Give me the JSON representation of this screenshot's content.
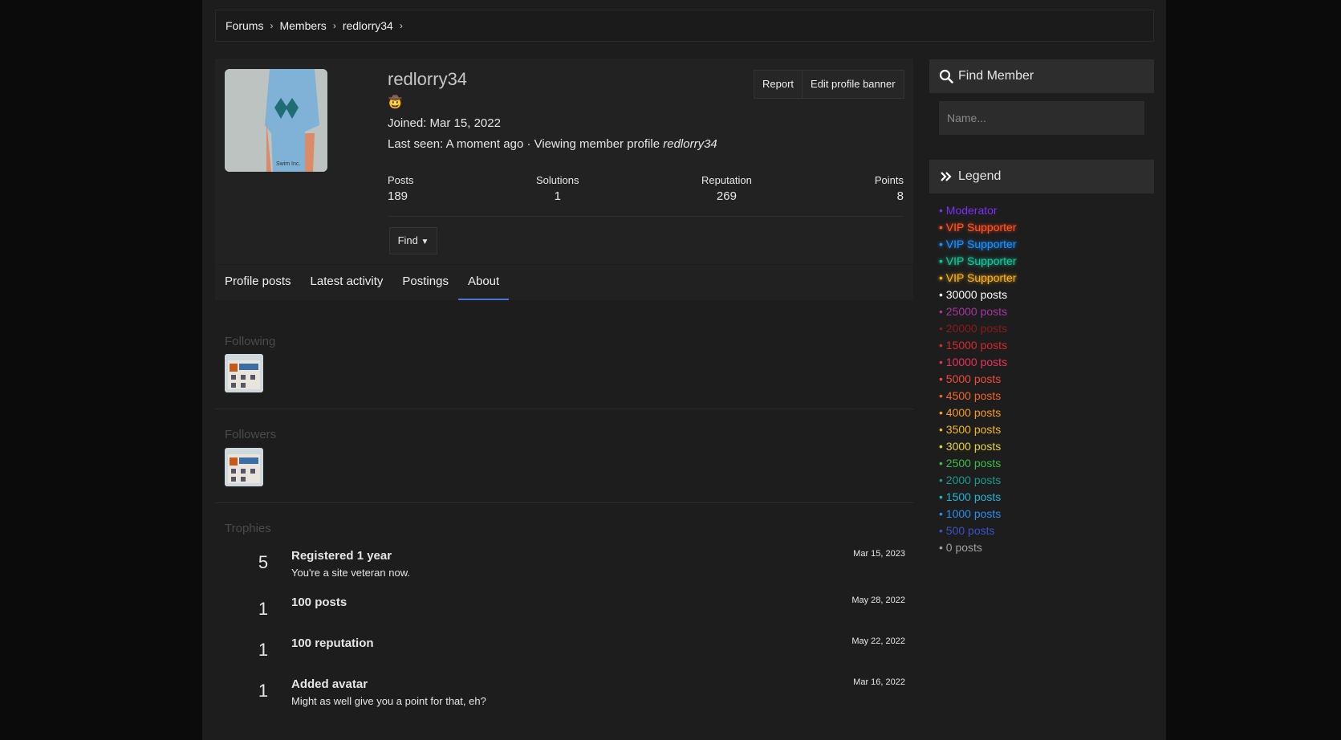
{
  "breadcrumb": {
    "items": [
      "Forums",
      "Members",
      "redlorry34"
    ]
  },
  "profile": {
    "username": "redlorry34",
    "badge_emoji": "🤠",
    "joined_label": "Joined:",
    "joined_value": "Mar 15, 2022",
    "last_seen_label": "Last seen:",
    "last_seen_value": "A moment ago · Viewing member profile",
    "last_seen_target": "redlorry34",
    "report_label": "Report",
    "edit_banner_label": "Edit profile banner",
    "find_label": "Find",
    "avatar_caption": "Swim Inc."
  },
  "stats": [
    {
      "label": "Posts",
      "value": "189"
    },
    {
      "label": "Solutions",
      "value": "1"
    },
    {
      "label": "Reputation",
      "value": "269"
    },
    {
      "label": "Points",
      "value": "8"
    }
  ],
  "tabs": [
    {
      "label": "Profile posts",
      "active": false
    },
    {
      "label": "Latest activity",
      "active": false
    },
    {
      "label": "Postings",
      "active": false
    },
    {
      "label": "About",
      "active": true
    }
  ],
  "about": {
    "following_title": "Following",
    "followers_title": "Followers",
    "trophies_title": "Trophies"
  },
  "trophies": [
    {
      "points": "5",
      "title": "Registered 1 year",
      "desc": "You're a site veteran now.",
      "date": "Mar 15, 2023"
    },
    {
      "points": "1",
      "title": "100 posts",
      "desc": "",
      "date": "May 28, 2022"
    },
    {
      "points": "1",
      "title": "100 reputation",
      "desc": "",
      "date": "May 22, 2022"
    },
    {
      "points": "1",
      "title": "Added avatar",
      "desc": "Might as well give you a point for that, eh?",
      "date": "Mar 16, 2022"
    }
  ],
  "sidebar": {
    "find_member_title": "Find Member",
    "name_placeholder": "Name...",
    "legend_title": "Legend",
    "legend": [
      {
        "label": "• Moderator",
        "color": "#7b2ff7"
      },
      {
        "label": "• VIP Supporter",
        "color": "#ff5a1f"
      },
      {
        "label": "• VIP Supporter",
        "color": "#1e90ff"
      },
      {
        "label": "• VIP Supporter",
        "color": "#16c79a"
      },
      {
        "label": "• VIP Supporter",
        "color": "#ffb020"
      },
      {
        "label": "• 30000 posts",
        "color": "#ffffff"
      },
      {
        "label": "• 25000 posts",
        "color": "#a7359e"
      },
      {
        "label": "• 20000 posts",
        "color": "#8b1a1a"
      },
      {
        "label": "• 15000 posts",
        "color": "#d42a2a"
      },
      {
        "label": "• 10000 posts",
        "color": "#e8325a"
      },
      {
        "label": "• 5000 posts",
        "color": "#f04a3a"
      },
      {
        "label": "• 4500 posts",
        "color": "#f2632a"
      },
      {
        "label": "• 4000 posts",
        "color": "#f59a23"
      },
      {
        "label": "• 3500 posts",
        "color": "#f5b623"
      },
      {
        "label": "• 3000 posts",
        "color": "#e8d23a"
      },
      {
        "label": "• 2500 posts",
        "color": "#3dbb4a"
      },
      {
        "label": "• 2000 posts",
        "color": "#1a9a8a"
      },
      {
        "label": "• 1500 posts",
        "color": "#1fb5d6"
      },
      {
        "label": "• 1000 posts",
        "color": "#2a8ef0"
      },
      {
        "label": "• 500 posts",
        "color": "#3a52c7"
      },
      {
        "label": "• 0 posts",
        "color": "#a0a0a0"
      }
    ]
  }
}
